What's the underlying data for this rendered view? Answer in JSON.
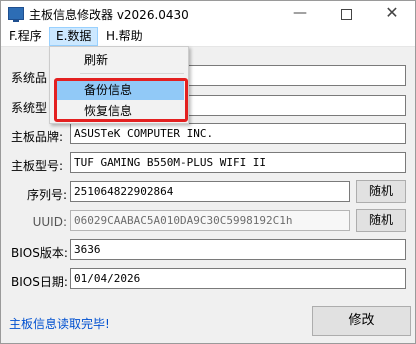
{
  "window": {
    "title": "主板信息修改器 v2026.0430",
    "minimize_label": "—",
    "close_label": "✕"
  },
  "menu": {
    "file": "F.程序",
    "data": "E.数据",
    "help": "H.帮助"
  },
  "dropdown": {
    "refresh": "刷新",
    "backup": "备份信息",
    "restore": "恢复信息"
  },
  "fields": {
    "system_product_label": "系统品",
    "system_model_label": "系统型",
    "board_brand_label": "主板品牌:",
    "board_brand_value": "ASUSTeK COMPUTER INC.",
    "board_model_label": "主板型号:",
    "board_model_value": "TUF GAMING B550M-PLUS WIFI II",
    "serial_label": "序列号:",
    "serial_value": "251064822902864",
    "uuid_label": "UUID:",
    "uuid_value": "06029CAABAC5A010DA9C30C5998192C1h",
    "bios_version_label": "BIOS版本:",
    "bios_version_value": "3636",
    "bios_date_label": "BIOS日期:",
    "bios_date_value": "01/04/2026"
  },
  "buttons": {
    "random": "随机",
    "modify": "修改"
  },
  "status": {
    "message": "主板信息读取完毕!"
  }
}
